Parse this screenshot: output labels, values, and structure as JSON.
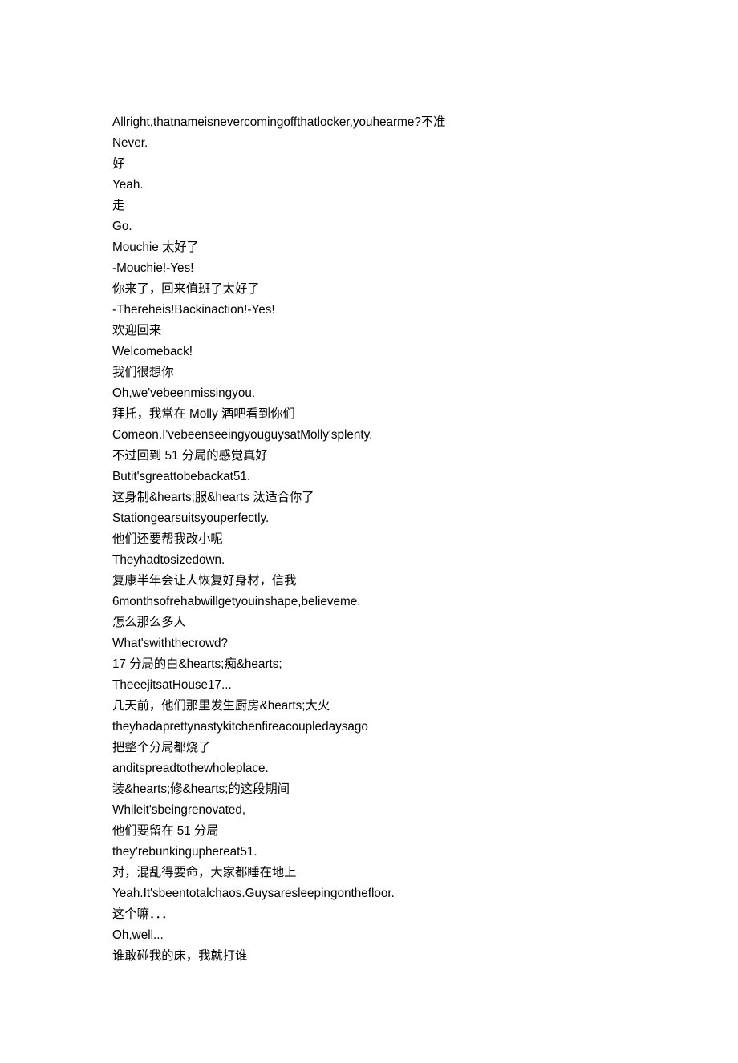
{
  "lines": [
    "Allright,thatnameisnevercomingoffthatlocker,youhearme?不准",
    "Never.",
    "好",
    "Yeah.",
    "走",
    "Go.",
    "Mouchie 太好了",
    "-Mouchie!-Yes!",
    "你来了，回来值班了太好了",
    "-Thereheis!Backinaction!-Yes!",
    "欢迎回来",
    "Welcomeback!",
    "我们很想你",
    "Oh,we'vebeenmissingyou.",
    "拜托，我常在 Molly 酒吧看到你们",
    "Comeon.I'vebeenseeingyouguysatMolly'splenty.",
    "不过回到 51 分局的感觉真好",
    "Butit'sgreattobebackat51.",
    "这身制&hearts;服&hearts 汰适合你了",
    "Stationgearsuitsyouperfectly.",
    "他们还要帮我改小呢",
    "Theyhadtosizedown.",
    "复康半年会让人恢复好身材，信我",
    "6monthsofrehabwillgetyouinshape,believeme.",
    "怎么那么多人",
    "What'swiththecrowd?",
    "17 分局的白&hearts;痴&hearts;",
    "TheeejitsatHouse17...",
    "几天前，他们那里发生厨房&hearts;大火",
    "theyhadaprettynastykitchenfireacoupledaysago",
    "把整个分局都烧了",
    "anditspreadtothewholeplace.",
    "装&hearts;修&hearts;的这段期间",
    "Whileit'sbeingrenovated,",
    "他们要留在 51 分局",
    "they'rebunkinguphereat51.",
    "对，混乱得要命，大家都睡在地上",
    "Yeah.It'sbeentotalchaos.Guysaresleepingonthefloor.",
    "这个嘛．．．",
    "Oh,well...",
    "谁敢碰我的床，我就打谁"
  ]
}
